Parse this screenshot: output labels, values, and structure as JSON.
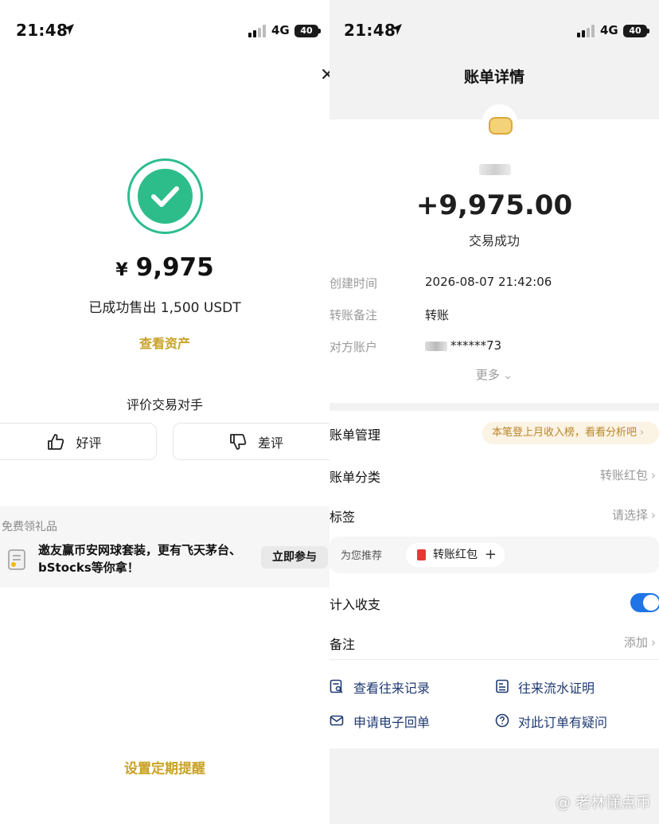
{
  "left_screen": {
    "status": {
      "time": "21:48",
      "network": "4G",
      "battery": "40"
    },
    "close_glyph": "✕",
    "amount": {
      "currency": "¥",
      "value": "9,975"
    },
    "sold_text": "已成功售出 1,500 USDT",
    "view_assets": "查看资产",
    "rate_title": "评价交易对手",
    "good_review": "好评",
    "bad_review": "差评",
    "promo": {
      "title": "免费领礼品",
      "text": "邀友赢币安网球套装，更有飞天茅台、bStocks等你拿！",
      "button": "立即参与"
    },
    "reminder": "设置定期提醒"
  },
  "right_screen": {
    "status": {
      "time": "21:48",
      "network": "4G",
      "battery": "40"
    },
    "title": "账单详情",
    "amount": "+9,975.00",
    "status_text": "交易成功",
    "details": [
      {
        "label": "创建时间",
        "value": "2026-08-07 21:42:06"
      },
      {
        "label": "转账备注",
        "value": "转账"
      },
      {
        "label": "对方账户",
        "value": "******73"
      }
    ],
    "more": "更多",
    "bill_management": {
      "label": "账单管理",
      "banner": "本笔登上月收入榜，看看分析吧"
    },
    "category": {
      "label": "账单分类",
      "value": "转账红包"
    },
    "tags": {
      "label": "标签",
      "value": "请选择"
    },
    "recommend": {
      "label": "为您推荐",
      "chip": "转账红包",
      "plus": "+"
    },
    "count_in_budget": {
      "label": "计入收支",
      "enabled": true
    },
    "remark": {
      "label": "备注",
      "value": "添加"
    },
    "links": {
      "history": "查看往来记录",
      "statement": "往来流水证明",
      "receipt": "申请电子回单",
      "question": "对此订单有疑问"
    },
    "watermark": "老林懂点币",
    "watermark_prefix": "@"
  },
  "colors": {
    "success_green": "#2dbd8b",
    "gold_link": "#c9a227",
    "toggle_blue": "#1f74e8"
  }
}
